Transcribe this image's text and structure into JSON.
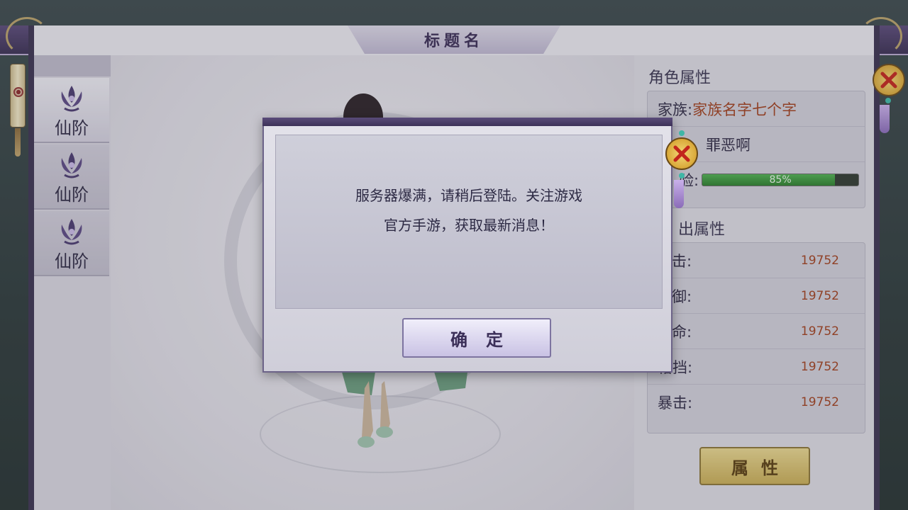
{
  "window": {
    "title": "标题名"
  },
  "sidebar": {
    "tabs": [
      {
        "label": "仙阶",
        "active": true
      },
      {
        "label": "仙阶",
        "active": false
      },
      {
        "label": "仙阶",
        "active": false
      }
    ]
  },
  "role_attributes": {
    "section_title": "角色属性",
    "family_label": "家族:",
    "family_value": "家族名字七个字",
    "partial_name": "罪恶啊",
    "exp_label_partial": "验:",
    "exp_percent": 85,
    "exp_text": "85%"
  },
  "base_attributes": {
    "section_title_partial": "出属性",
    "rows": [
      {
        "label": "击:",
        "value": "19752"
      },
      {
        "label": "御:",
        "value": "19752"
      },
      {
        "label": "命:",
        "value": "19752"
      },
      {
        "label": "格挡:",
        "value": "19752"
      },
      {
        "label": "暴击:",
        "value": "19752"
      }
    ]
  },
  "attr_button": {
    "label": "属性"
  },
  "dialog": {
    "message_line1": "服务器爆满，请稍后登陆。关注游戏",
    "message_line2": "官方手游，获取最新消息！",
    "confirm_label": "确定"
  },
  "icons": {
    "close": "close-x-icon",
    "lotus": "lotus-emblem-icon"
  },
  "colors": {
    "accent_purple": "#3a2f52",
    "value_red": "#a0401e",
    "exp_green": "#2c7f2c",
    "gold_button": "#c8ad55"
  }
}
